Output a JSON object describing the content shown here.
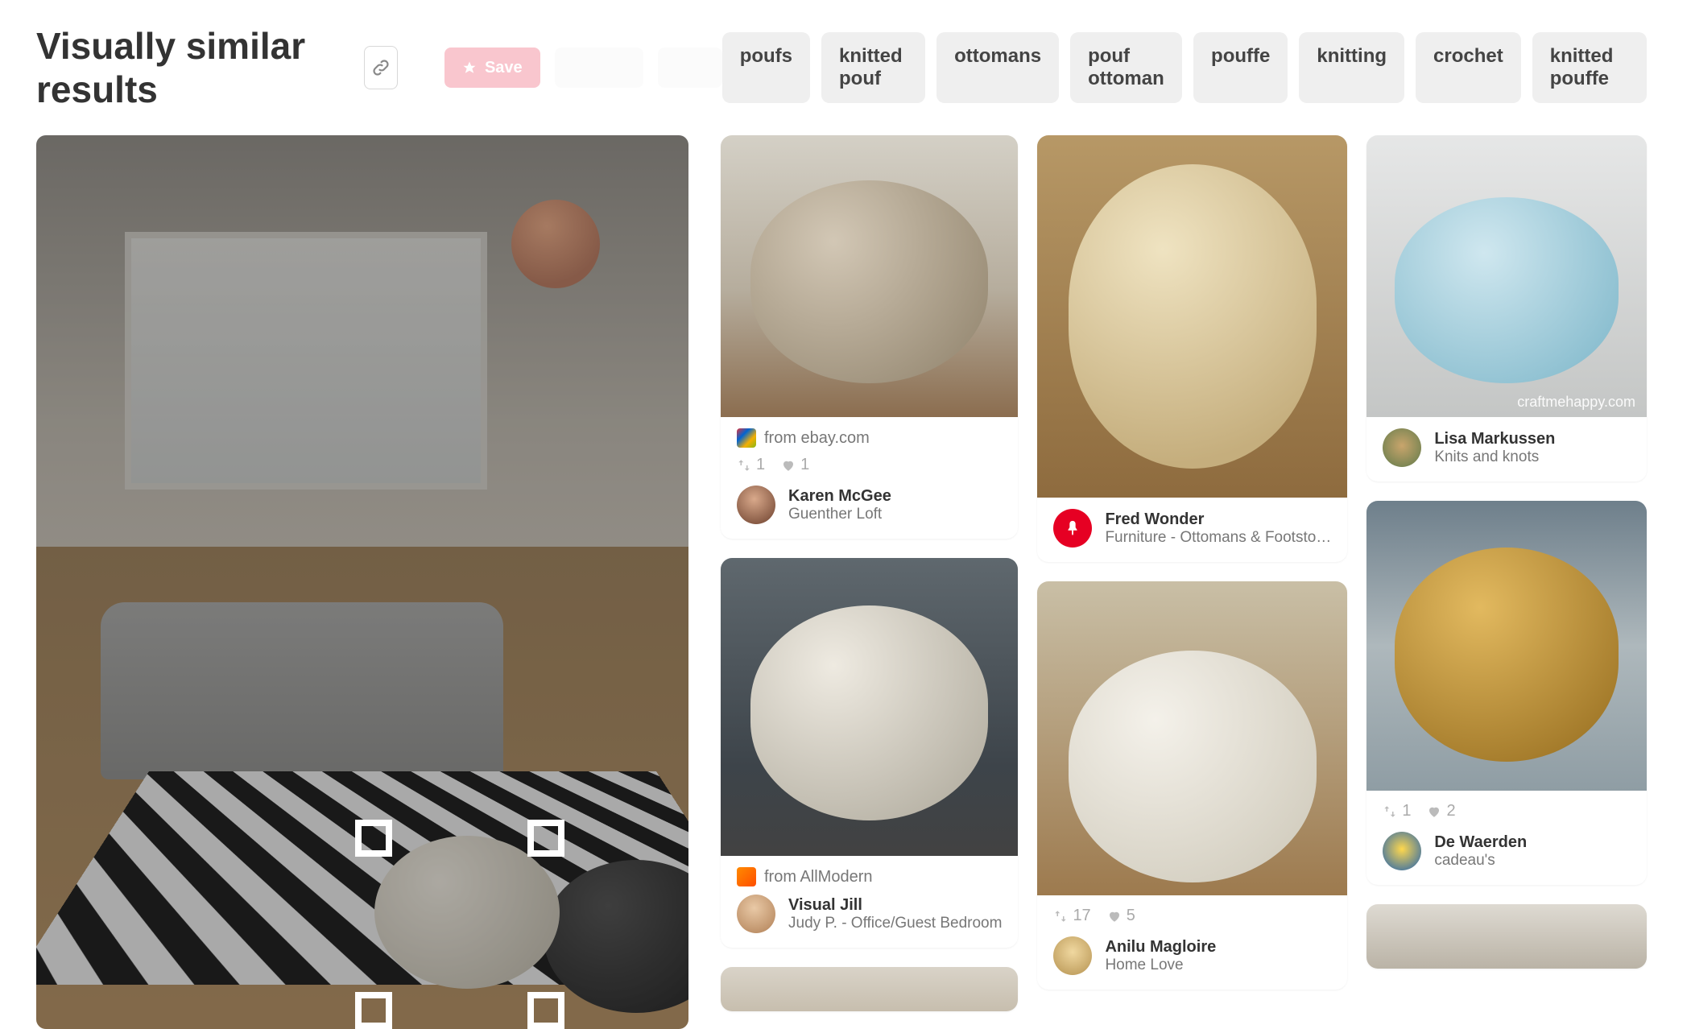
{
  "header": {
    "title": "Visually similar results",
    "ghost_save": "Save"
  },
  "tags": [
    "poufs",
    "knitted pouf",
    "ottomans",
    "pouf ottoman",
    "pouffe",
    "knitting",
    "crochet",
    "knitted pouffe"
  ],
  "columns": [
    [
      {
        "id": "a",
        "img_class": "img-a",
        "source_text": "from ebay.com",
        "favicon_bg": "linear-gradient(135deg,#e53238,#0064d2,#f5af02,#86b817)",
        "pins": "1",
        "likes": "1",
        "avatar_bg": "radial-gradient(circle at 45% 35%,#d9a98b,#6b3f2c)",
        "user_name": "Karen McGee",
        "board": "Guenther Loft"
      },
      {
        "id": "b",
        "img_class": "img-b",
        "source_text": "from AllModern",
        "favicon_bg": "linear-gradient(135deg,#ff8a00,#ff4e00)",
        "avatar_bg": "radial-gradient(circle at 45% 35%,#e9c9a6,#b07f55)",
        "user_name": "Visual Jill",
        "board": "Judy P. - Office/Guest Bedroom"
      },
      {
        "id": "c",
        "img_class": "img-c",
        "partial": true
      }
    ],
    [
      {
        "id": "d",
        "img_class": "img-d",
        "avatar_bg": "#e60023",
        "avatar_is_pin": true,
        "user_name": "Fred Wonder",
        "board": "Furniture - Ottomans & Footsto…"
      },
      {
        "id": "e",
        "img_class": "img-e",
        "pins": "17",
        "likes": "5",
        "avatar_bg": "radial-gradient(circle at 50% 40%,#f0d8a0,#b59250)",
        "user_name": "Anilu Magloire",
        "board": "Home Love"
      }
    ],
    [
      {
        "id": "f",
        "img_class": "img-f",
        "watermark": "craftmehappy.com",
        "avatar_bg": "radial-gradient(circle at 50% 45%,#c9a56c,#5f7a4a)",
        "user_name": "Lisa Markussen",
        "board": "Knits and knots"
      },
      {
        "id": "g",
        "img_class": "img-g",
        "pins": "1",
        "likes": "2",
        "avatar_bg": "radial-gradient(circle at 50% 45%,#ffd84d,#1b5fb3)",
        "user_name": "De Waerden",
        "board": "cadeau's"
      },
      {
        "id": "h",
        "img_class": "img-h",
        "partial": true
      }
    ]
  ]
}
